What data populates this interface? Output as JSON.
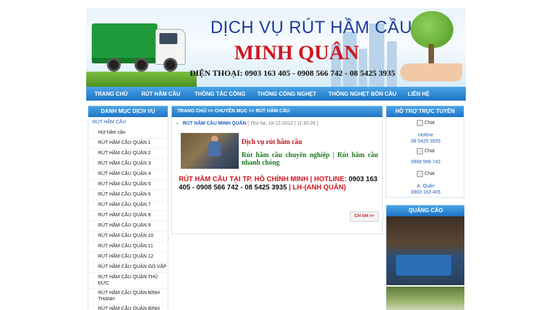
{
  "banner": {
    "title_line1": "DỊCH VỤ RÚT HẦM CẦU",
    "title_line2": "MINH QUÂN",
    "phone_line": "ĐIỆN THOẠI: 0903 163 405 - 0908 566 742 - 08 5425 3935"
  },
  "nav": {
    "items": [
      "TRANG CHỦ",
      "RÚT HẦM CẦU",
      "THÔNG TẮC CỐNG",
      "THÔNG CỐNG NGHẸT",
      "THÔNG NGHẸT BỒN CẦU",
      "LIÊN HỆ"
    ]
  },
  "left_sidebar": {
    "title": "DANH MỤC DỊCH VỤ",
    "category": "RÚT HẦM CẦU",
    "items": [
      "Hút hầm cầu",
      "RÚT HẦM CẦU QUẬN 1",
      "RÚT HẦM CẦU QUẬN 2",
      "RÚT HẦM CẦU QUẬN 3",
      "RÚT HẦM CẦU QUẬN 4",
      "RÚT HẦM CẦU QUẬN 5",
      "RÚT HẦM CẦU QUẬN 6",
      "RÚT HẦM CẦU QUẬN 7",
      "RÚT HẦM CẦU QUẬN 8",
      "RÚT HẦM CẦU QUẬN 9",
      "RÚT HẦM CẦU QUẬN 10",
      "RÚT HẦM CẦU QUẬN 11",
      "RÚT HẦM CẦU QUẬN 12",
      "RÚT HẦM CẦU QUẬN GÒ VẤP",
      "RÚT HẦM CẦU QUẬN THỦ ĐỨC",
      "RÚT HẦM CẦU QUẬN BÌNH THẠNH",
      "RÚT HẦM CẦU QUẬN BÌNH TÂN"
    ]
  },
  "main": {
    "breadcrumb": "TRANG CHỦ >> CHUYÊN MỤC >> RÚT HẦM CẦU",
    "post": {
      "title": "RÚT HẦM CẦU MINH QUÂN",
      "date": "[ Thứ ba, 18-12-2012 | 11:30:26 ]",
      "excerpt_line1": "Dịch vụ rút hầm cầu",
      "excerpt_line2": "Rút hầm cầu chuyên nghiệp | Rút hầm cầu nhanh chóng",
      "excerpt_red1": "RÚT HẦM CẦU TẠI TP. HỒ CHÍNH MINH | HOTLINE:",
      "excerpt_black": " 0903 163 405 - 0908 566 742 - 08 5425 3935 ",
      "excerpt_red2": "| LH-(ANH QUÂN)",
      "detail_label": "Chi tiết >>"
    }
  },
  "right_sidebar": {
    "support_title": "HỖ TRỢ TRỰC TUYẾN",
    "chat_label": "Chat",
    "contacts": [
      {
        "name": "Hotline",
        "phone": "08 5425 3935"
      },
      {
        "name": "",
        "phone": "0908 566 742"
      },
      {
        "name": "A. Quân",
        "phone": "0903 163 405"
      }
    ],
    "ads_title": "QUẢNG CÁO"
  },
  "colors": {
    "nav_blue": "#1d74c6",
    "title_blue": "#1c3d9c",
    "brand_red": "#d0161e",
    "excerpt_green": "#1f7a1f"
  }
}
